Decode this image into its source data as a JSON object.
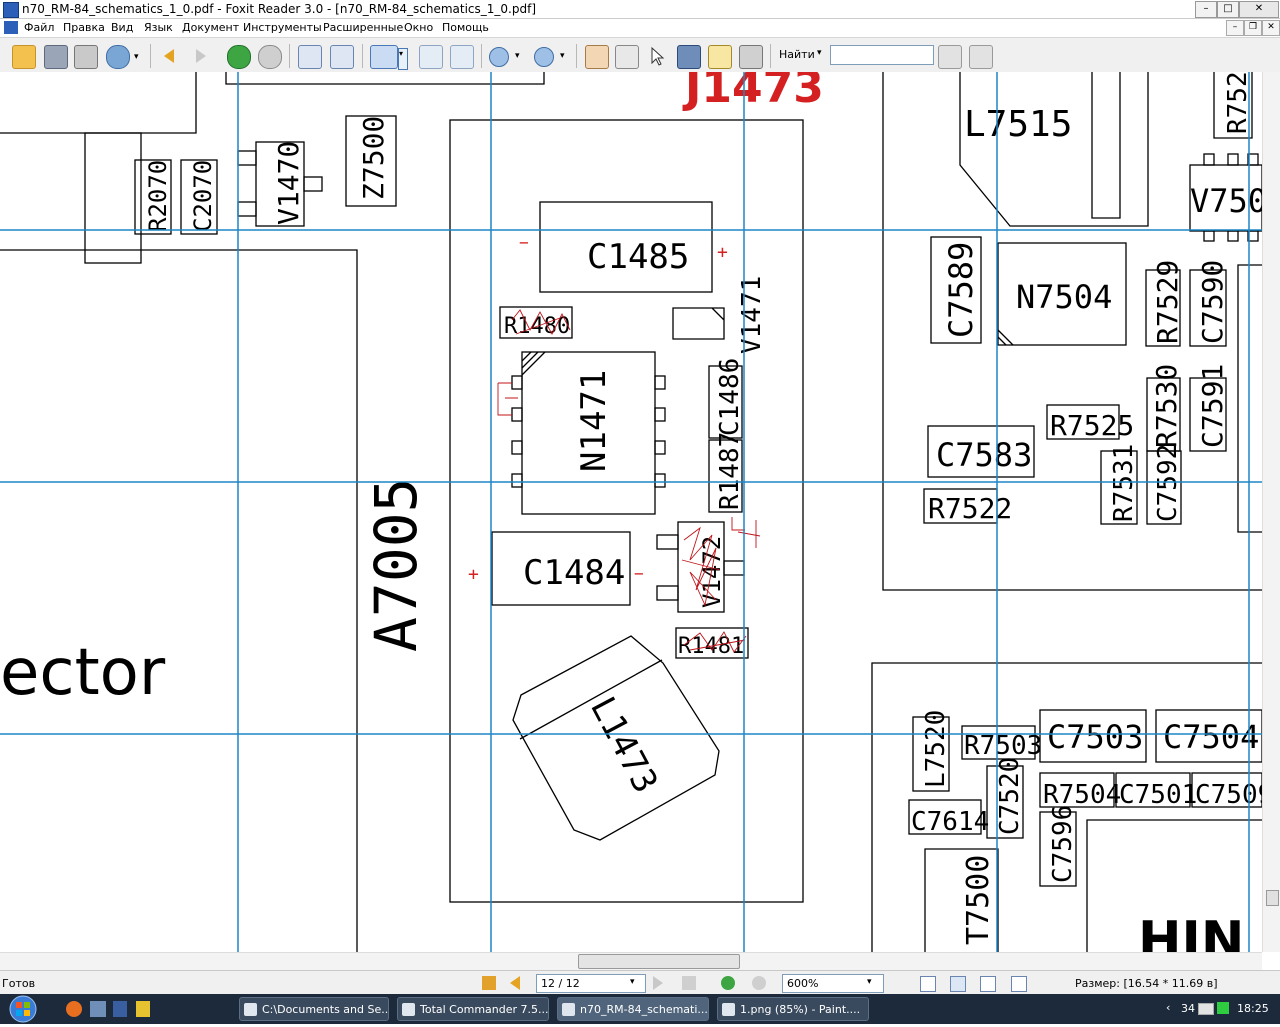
{
  "window": {
    "title": "n70_RM-84_schematics_1_0.pdf - Foxit Reader 3.0 - [n70_RM-84_schematics_1_0.pdf]",
    "minimize": "–",
    "maximize": "□",
    "close": "✕"
  },
  "menu": {
    "items": [
      "Файл",
      "Правка",
      "Вид",
      "Язык",
      "Документ",
      "Инструменты",
      "Расширенные",
      "Окно",
      "Помощь"
    ],
    "mdi_min": "–",
    "mdi_restore": "❐",
    "mdi_close": "✕"
  },
  "toolbar": {
    "find_label": "Найти",
    "find_dropdown": "▾",
    "find_value": ""
  },
  "schematic": {
    "labels": {
      "j1473": "J1473",
      "l7515": "L7515",
      "r752": "R752",
      "v750": "V750",
      "r2070": "R2070",
      "c2070": "C2070",
      "v1470": "V1470",
      "z7500": "Z7500",
      "c1485": "C1485",
      "c7589": "C7589",
      "n7504": "N7504",
      "r7529": "R7529",
      "c7590": "C7590",
      "r1480": "R1480",
      "v1471": "V1471",
      "n1471": "N1471",
      "c1486": "C1486",
      "r1487": "R1487",
      "r7525": "R7525",
      "r7530": "R7530",
      "c7591": "C7591",
      "c7583": "C7583",
      "r7531": "R7531",
      "c7592": "C7592",
      "r7522": "R7522",
      "a7005": "A7005",
      "c1484": "C1484",
      "v1472": "V1472",
      "r1481": "R1481",
      "ector": "ector",
      "l1473": "L1473",
      "l7520": "L7520",
      "r7503": "R7503",
      "c7503": "C7503",
      "c7504": "C7504",
      "r7504": "R7504",
      "c7501": "C7501",
      "c7509": "C7509",
      "c7614": "C7614",
      "c7520": "C7520",
      "c7596": "C7596",
      "t7500": "T7500",
      "hin": "HIN",
      "plus": "+",
      "minus": "−"
    }
  },
  "status": {
    "ready": "Готов",
    "page": "12 / 12",
    "zoom": "600%",
    "size": "Размер: [16.54 * 11.69 в]"
  },
  "taskbar": {
    "tasks": [
      "C:\\Documents and Se...",
      "Total Commander 7.5...",
      "n70_RM-84_schemati...",
      "1.png (85%) - Paint...."
    ],
    "tray_number": "34",
    "time": "18:25"
  },
  "colors": {
    "grid": "#1f86c8",
    "red_label": "#d42020",
    "scribble": "#c0141a"
  }
}
